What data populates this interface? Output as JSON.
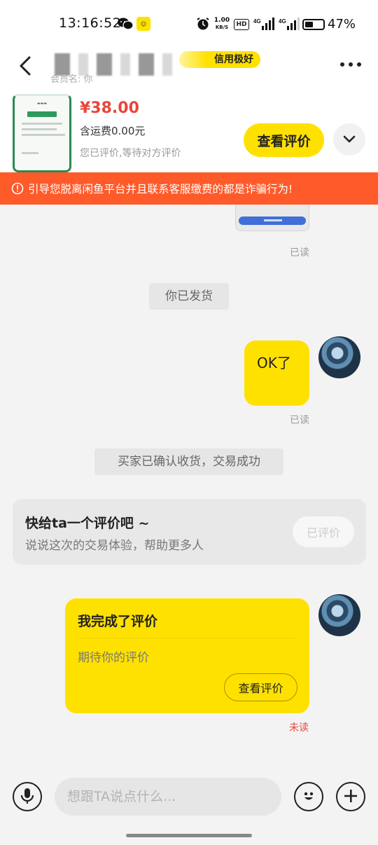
{
  "status_bar": {
    "time": "13:16:52",
    "net_speed_value": "1.00",
    "net_speed_unit": "KB/S",
    "hd": "HD",
    "signal1": "4G",
    "signal2": "4G",
    "battery_percent": "47%",
    "battery_level": 0.47
  },
  "header": {
    "credit_badge": "信用极好",
    "sub_label": "会员名: 你"
  },
  "product": {
    "price": "¥38.00",
    "shipping": "含运费0.00元",
    "status": "您已评价,等待对方评价",
    "review_button": "查看评价"
  },
  "warning": {
    "text": "引导您脱离闲鱼平台并且联系客服缴费的都是诈骗行为!"
  },
  "chat": {
    "read_label_1": "已读",
    "system_shipped": "你已发货",
    "ok_message": "OK了",
    "read_label_2": "已读",
    "system_confirmed": "买家已确认收货，交易成功",
    "review_prompt": {
      "title": "快给ta一个评价吧 ~",
      "subtitle": "说说这次的交易体验，帮助更多人",
      "button": "已评价"
    },
    "review_done": {
      "title": "我完成了评价",
      "subtitle": "期待你的评价",
      "button": "查看评价"
    },
    "unread_label": "未读"
  },
  "input": {
    "placeholder": "想跟TA说点什么..."
  }
}
